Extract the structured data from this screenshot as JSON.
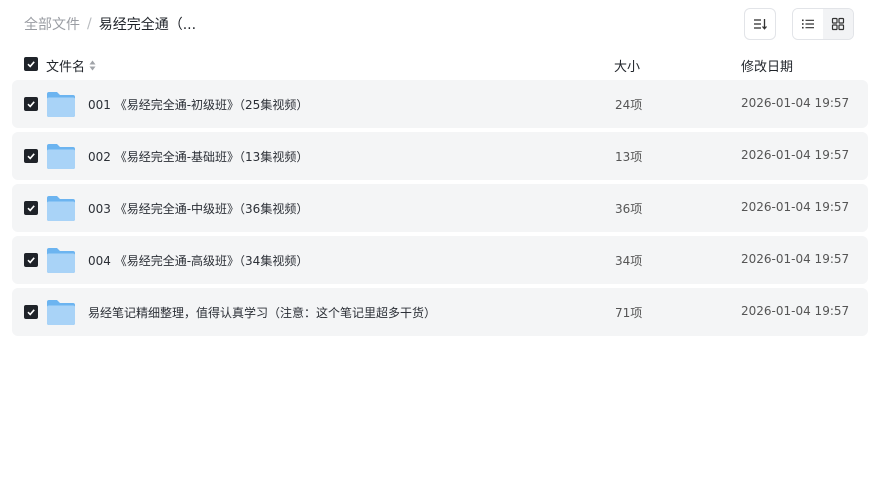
{
  "breadcrumb": {
    "root": "全部文件",
    "separator": "/",
    "current": "易经完全通（..."
  },
  "toolbar": {
    "sort_icon": "sort-lines-icon",
    "list_view_icon": "list-view-icon",
    "grid_view_icon": "grid-view-icon",
    "active_view": "list"
  },
  "table": {
    "columns": {
      "name": "文件名",
      "size": "大小",
      "modified": "修改日期"
    },
    "rows": [
      {
        "name": "001 《易经完全通-初级班》（25集视频）",
        "size": "24项",
        "modified": "2026-01-04 19:57",
        "checked": true,
        "icon": "folder-icon"
      },
      {
        "name": "002 《易经完全通-基础班》（13集视频）",
        "size": "13项",
        "modified": "2026-01-04 19:57",
        "checked": true,
        "icon": "folder-icon"
      },
      {
        "name": "003 《易经完全通-中级班》（36集视频）",
        "size": "36项",
        "modified": "2026-01-04 19:57",
        "checked": true,
        "icon": "folder-icon"
      },
      {
        "name": "004 《易经完全通-高级班》（34集视频）",
        "size": "34项",
        "modified": "2026-01-04 19:57",
        "checked": true,
        "icon": "folder-icon"
      },
      {
        "name": "易经笔记精细整理，值得认真学习（注意：这个笔记里超多干货）",
        "size": "71项",
        "modified": "2026-01-04 19:57",
        "checked": true,
        "icon": "folder-icon"
      }
    ]
  },
  "colors": {
    "row_bg": "#f4f5f6",
    "checkbox": "#1f2329",
    "folder_light": "#a9d3f7",
    "folder_dark": "#6cb4f0"
  }
}
